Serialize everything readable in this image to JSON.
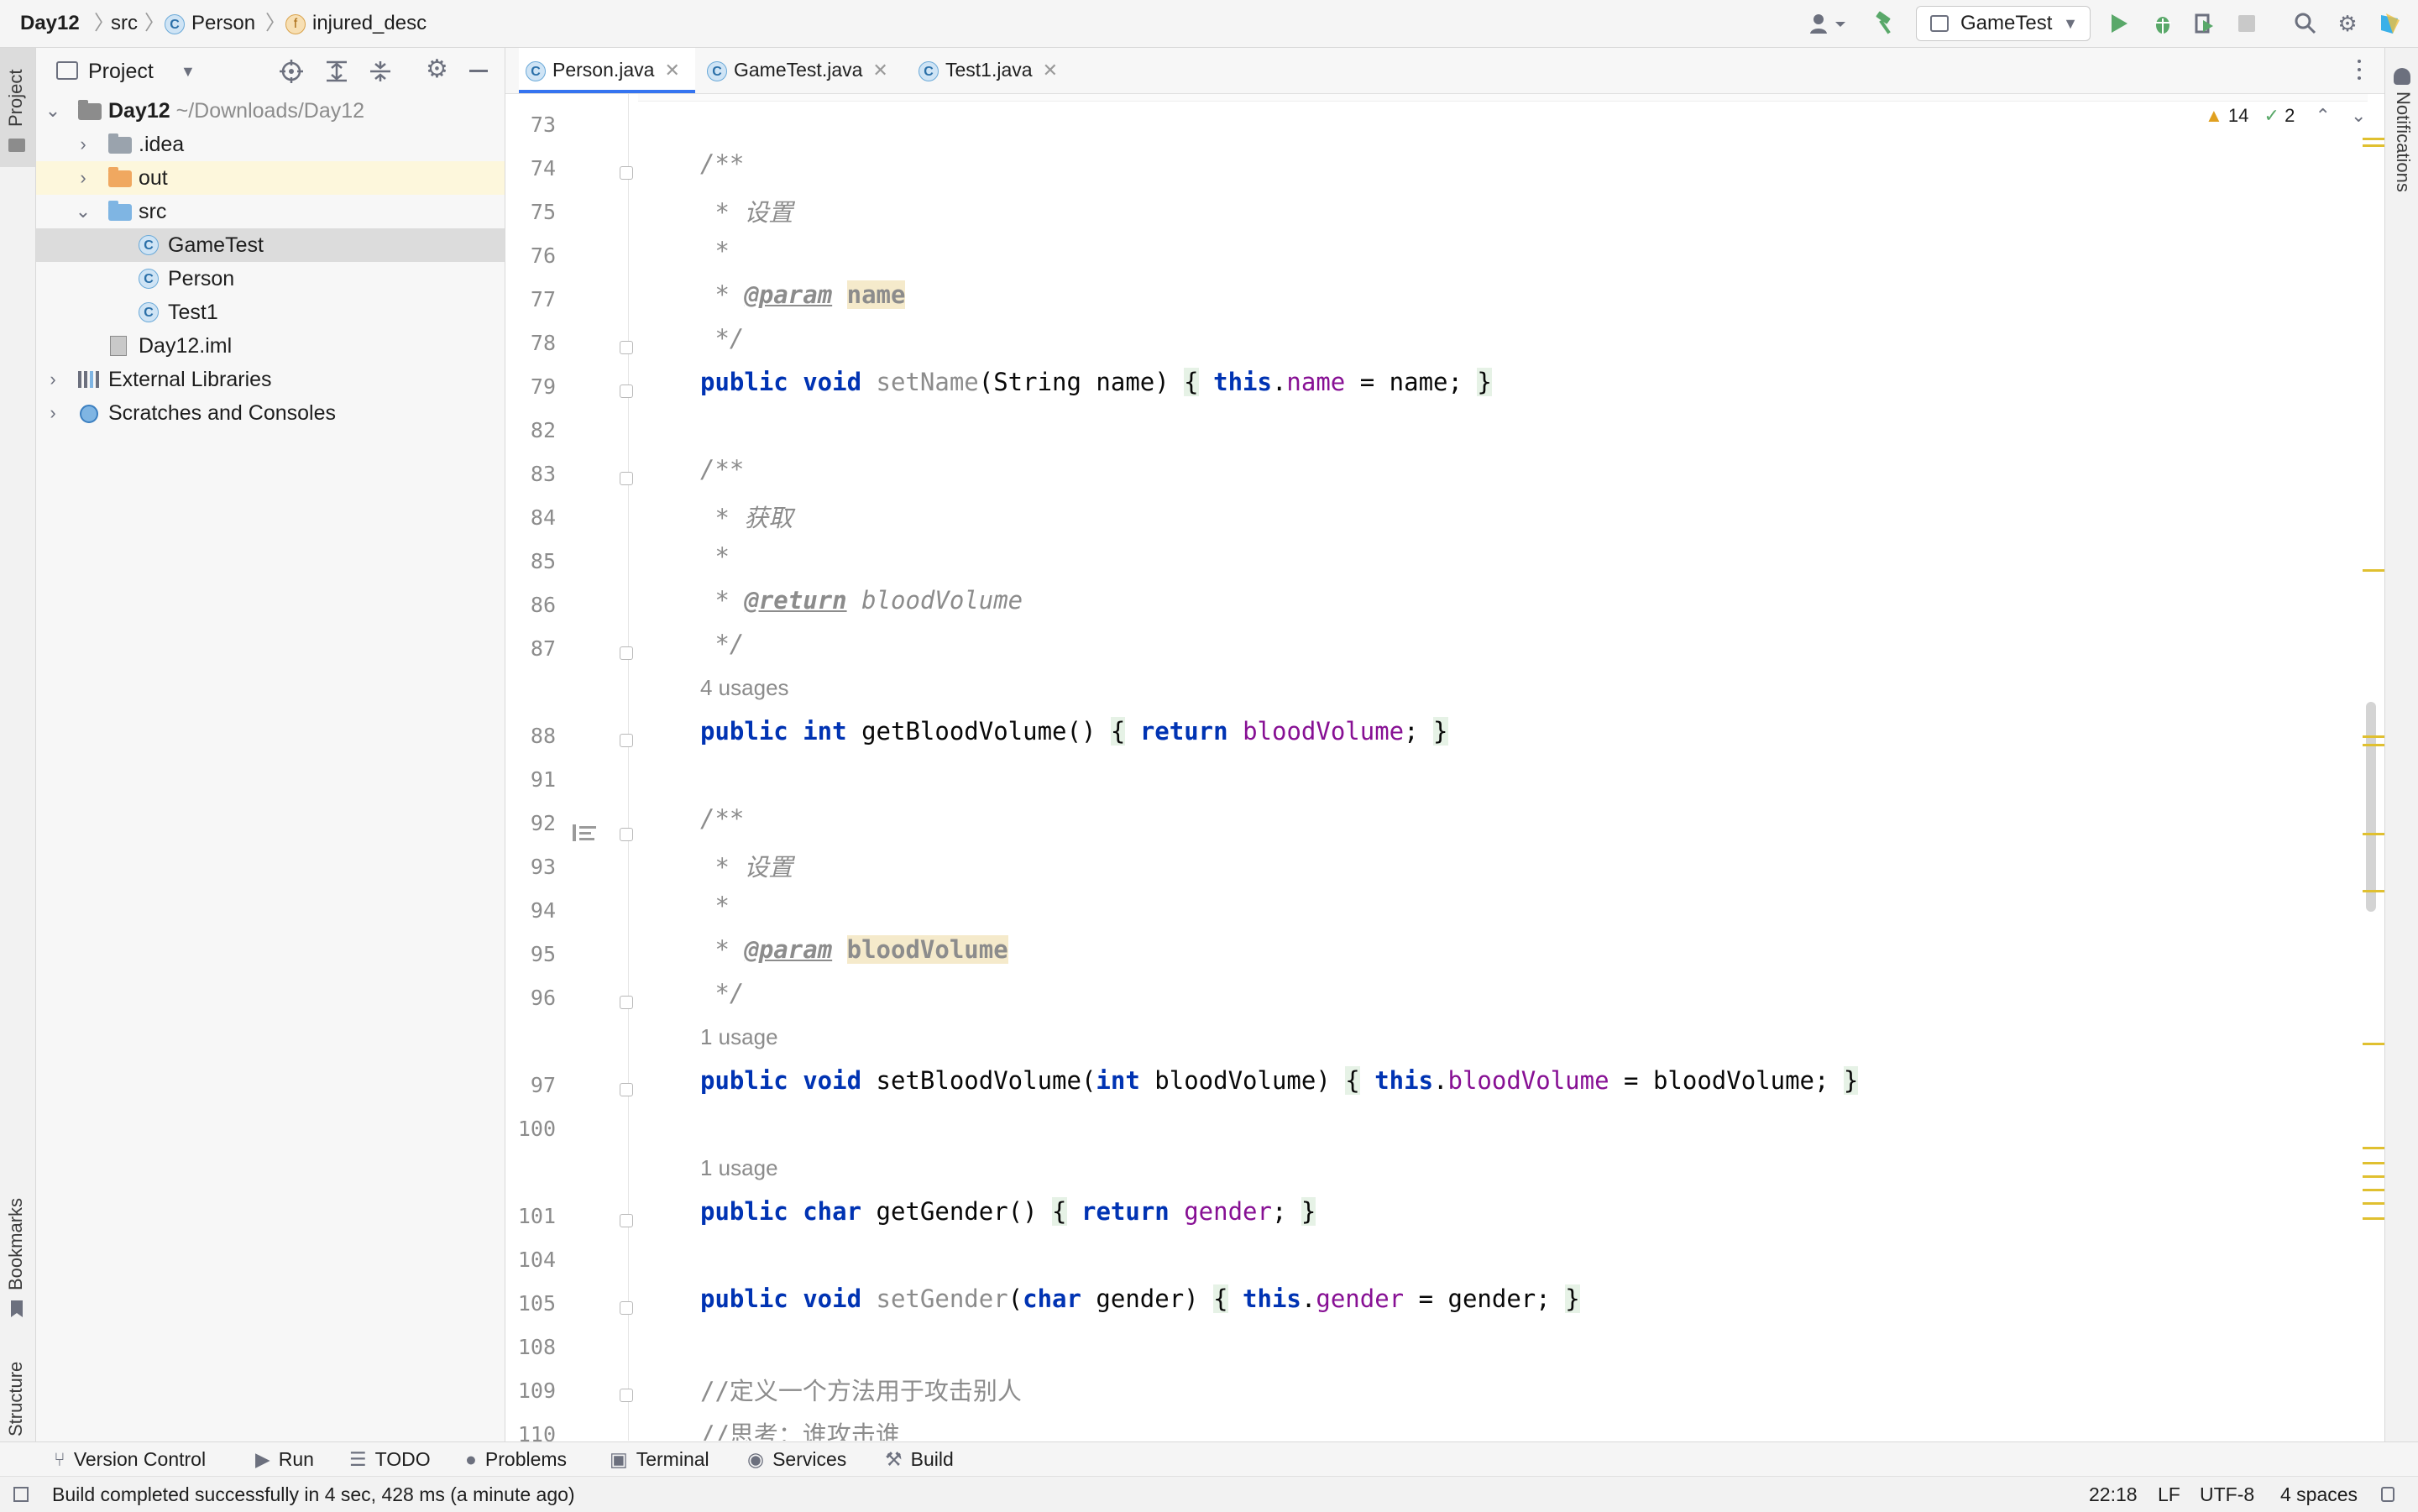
{
  "breadcrumb": {
    "project": "Day12",
    "folder": "src",
    "class": "Person",
    "field": "injured_desc"
  },
  "run_config": "GameTest",
  "project_panel": {
    "title": "Project",
    "tree": [
      {
        "label": "Day12",
        "path": "~/Downloads/Day12"
      },
      {
        "label": ".idea"
      },
      {
        "label": "out"
      },
      {
        "label": "src"
      },
      {
        "label": "GameTest"
      },
      {
        "label": "Person"
      },
      {
        "label": "Test1"
      },
      {
        "label": "Day12.iml"
      },
      {
        "label": "External Libraries"
      },
      {
        "label": "Scratches and Consoles"
      }
    ]
  },
  "left_strip": {
    "project": "Project",
    "bookmarks": "Bookmarks",
    "structure": "Structure"
  },
  "right_strip": {
    "notifications": "Notifications"
  },
  "tabs": [
    {
      "label": "Person.java",
      "icon": "class-icon"
    },
    {
      "label": "GameTest.java",
      "icon": "class-run-icon"
    },
    {
      "label": "Test1.java",
      "icon": "class-icon"
    }
  ],
  "inspections": {
    "warnings": "14",
    "typos": "2"
  },
  "editor": {
    "lines": [
      "73",
      "74",
      "75",
      "76",
      "77",
      "78",
      "79",
      "82",
      "83",
      "84",
      "85",
      "86",
      "87",
      "88",
      "91",
      "92",
      "93",
      "94",
      "95",
      "96",
      "97",
      "100",
      "101",
      "104",
      "105",
      "108",
      "109",
      "110"
    ],
    "usages": {
      "u88": "4 usages",
      "u97": "1 usage",
      "u101": "1 usage"
    },
    "text": {
      "c74": "/**",
      "c75": " * 设置",
      "c76": " *",
      "c77_tag": "@param",
      "c77_name": "name",
      "c78": " */",
      "c79_name": "setName",
      "c83": "/**",
      "c84": " * 获取",
      "c85": " *",
      "c86_tag": "@return",
      "c86_name": "bloodVolume",
      "c87": " */",
      "c88_name": "getBloodVolume",
      "c92": "/**",
      "c93": " * 设置",
      "c94": " *",
      "c95_tag": "@param",
      "c95_name": "bloodVolume",
      "c96": " */",
      "c97_name": "setBloodVolume",
      "c101_name": "getGender",
      "c105_name": "setGender",
      "c109": "//定义一个方法用于攻击别人",
      "c110": "//思考：谁攻击谁"
    }
  },
  "bottom_tools": [
    "Version Control",
    "Run",
    "TODO",
    "Problems",
    "Terminal",
    "Services",
    "Build"
  ],
  "status": {
    "message": "Build completed successfully in 4 sec, 428 ms (a minute ago)",
    "position": "22:18",
    "line_sep": "LF",
    "encoding": "UTF-8",
    "indent": "4 spaces"
  }
}
